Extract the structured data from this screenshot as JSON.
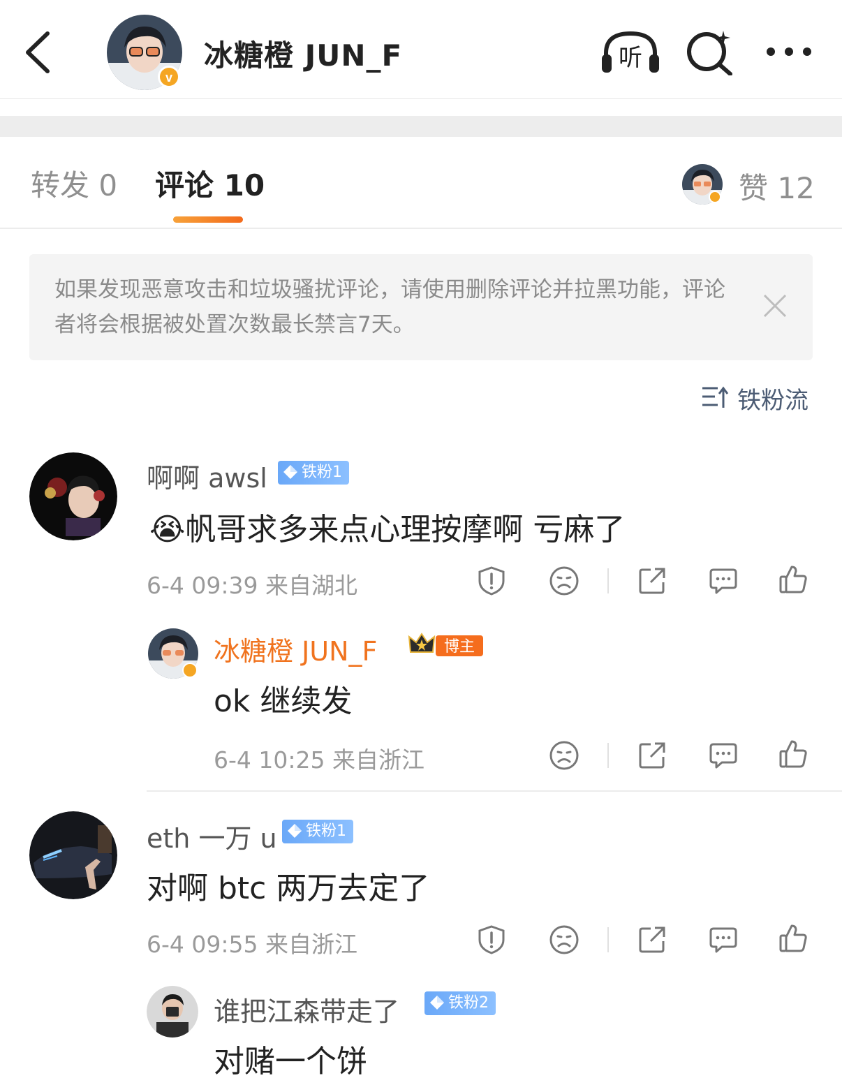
{
  "header": {
    "title": "冰糖橙 JUN_F",
    "listen_label": "听"
  },
  "tabs": {
    "repost": "转发 0",
    "comment": "评论 10",
    "likes": "赞 12"
  },
  "notice": {
    "text": "如果发现恶意攻击和垃圾骚扰评论，请使用删除评论并拉黑功能，评论者将会根据被处置次数最长禁言7天。"
  },
  "sort": {
    "label": "铁粉流"
  },
  "comments": [
    {
      "user": "啊啊 awsl",
      "badge": "铁粉1",
      "emoji": "😭",
      "text": "帆哥求多来点心理按摩啊 亏麻了",
      "meta": "6-4 09:39 来自湖北",
      "reply": {
        "user": "冰糖橙 JUN_F",
        "badge": "博主",
        "text": "ok 继续发",
        "meta": "6-4 10:25 来自浙江"
      }
    },
    {
      "user": "eth 一万 u",
      "badge": "铁粉1",
      "text": "对啊 btc 两万去定了",
      "meta": "6-4 09:55 来自浙江",
      "reply": {
        "user": "谁把江森带走了",
        "badge": "铁粉2",
        "text": "对赌一个饼"
      }
    }
  ],
  "colors": {
    "accent_orange": "#f36b1c",
    "fan_badge_blue": "#6aa8f8",
    "verified_orange": "#f5a623"
  }
}
